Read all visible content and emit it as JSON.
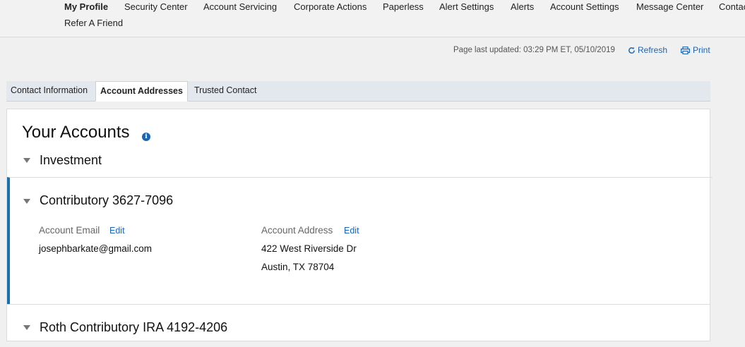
{
  "topnav": {
    "items": [
      "My Profile",
      "Security Center",
      "Account Servicing",
      "Corporate Actions",
      "Paperless",
      "Alert Settings",
      "Alerts",
      "Account Settings",
      "Message Center",
      "Contac"
    ],
    "row2": "Refer A Friend"
  },
  "status": {
    "updated": "Page last updated: 03:29 PM ET, 05/10/2019",
    "refresh": "Refresh",
    "print": "Print"
  },
  "tabs": [
    "Contact Information",
    "Account Addresses",
    "Trusted Contact"
  ],
  "main": {
    "title": "Your Accounts",
    "info_icon": "i",
    "group": "Investment",
    "accounts": [
      {
        "name": "Contributory 3627-7096",
        "email_label": "Account Email",
        "email_edit": "Edit",
        "email": "josephbarkate@gmail.com",
        "address_label": "Account Address",
        "address_edit": "Edit",
        "address_line1": "422 West Riverside Dr",
        "address_line2": "Austin, TX 78704"
      },
      {
        "name": "Roth Contributory IRA 4192-4206"
      }
    ]
  },
  "colors": {
    "accent": "#1a66b3",
    "selected_bar": "#1a6fb0"
  }
}
